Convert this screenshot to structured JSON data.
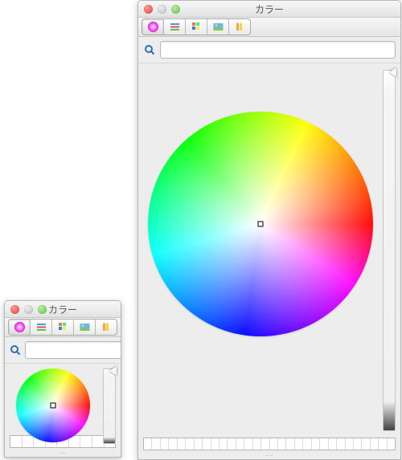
{
  "windows": {
    "small": {
      "title": "カラー",
      "search_value": "",
      "search_placeholder": ""
    },
    "large": {
      "title": "カラー",
      "search_value": "",
      "search_placeholder": ""
    }
  },
  "tabs": [
    {
      "id": "wheel",
      "active": true
    },
    {
      "id": "sliders",
      "active": false
    },
    {
      "id": "palette",
      "active": false
    },
    {
      "id": "image",
      "active": false
    },
    {
      "id": "crayons",
      "active": false
    }
  ],
  "colorwheel": {
    "selected_hue_deg": 0,
    "selected_sat": 0.0,
    "brightness": 1.0
  },
  "swatches_count": 9,
  "swatches_count_large": 30,
  "colors": {
    "traffic_red": "#e0443e",
    "traffic_gray": "#bdbdbd",
    "traffic_green": "#5fc14e"
  }
}
